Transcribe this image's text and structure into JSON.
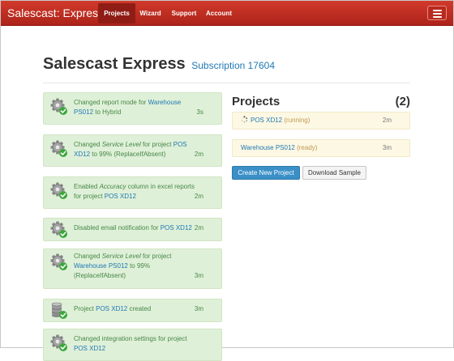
{
  "navbar": {
    "brand": "Salescast: Express",
    "items": [
      {
        "label": "Projects",
        "active": true
      },
      {
        "label": "Wizard",
        "active": false
      },
      {
        "label": "Support",
        "active": false
      },
      {
        "label": "Account",
        "active": false
      }
    ],
    "menu_icon": "hamburger-menu-icon"
  },
  "header": {
    "title": "Salescast Express",
    "subscription": "Subscription 17604"
  },
  "feed": [
    {
      "icon": "gear-check-icon",
      "time": "3s",
      "parts": [
        {
          "t": "Changed report mode for "
        },
        {
          "t": "Warehouse PS012",
          "link": true
        },
        {
          "t": " to Hybrid"
        }
      ]
    },
    {
      "icon": "gear-check-icon",
      "time": "2m",
      "parts": [
        {
          "t": "Changed "
        },
        {
          "t": "Service Level",
          "em": true
        },
        {
          "t": " for project "
        },
        {
          "t": "POS XD12",
          "link": true
        },
        {
          "t": " to 99% (ReplaceIfAbsent)"
        }
      ]
    },
    {
      "icon": "gear-check-icon",
      "time": "2m",
      "parts": [
        {
          "t": "Enabled "
        },
        {
          "t": "Accuracy",
          "em": true
        },
        {
          "t": " column in excel reports for project "
        },
        {
          "t": "POS XD12",
          "link": true
        }
      ]
    },
    {
      "icon": "gear-check-icon",
      "time": "2m",
      "parts": [
        {
          "t": "Disabled email notification for "
        },
        {
          "t": "POS XD12",
          "link": true
        }
      ]
    },
    {
      "icon": "gear-check-icon",
      "time": "3m",
      "parts": [
        {
          "t": "Changed "
        },
        {
          "t": "Service Level",
          "em": true
        },
        {
          "t": " for project "
        },
        {
          "t": "Warehouse PS012",
          "link": true
        },
        {
          "t": " to 99% (ReplaceIfAbsent)"
        }
      ]
    },
    {
      "icon": "database-check-icon",
      "time": "3m",
      "parts": [
        {
          "t": "Project "
        },
        {
          "t": "POS XD12",
          "link": true
        },
        {
          "t": " created"
        }
      ]
    },
    {
      "icon": "gear-check-icon",
      "time": "",
      "parts": [
        {
          "t": "Changed integration settings for project "
        },
        {
          "t": "POS XD12",
          "link": true
        }
      ]
    }
  ],
  "projects": {
    "heading": "Projects",
    "count": "(2)",
    "items": [
      {
        "icon": "spinner-icon",
        "name": "POS XD12",
        "status": "(running)",
        "time": "2m"
      },
      {
        "name": "Warehouse PS012",
        "status": "(ready)",
        "time": "3m"
      }
    ],
    "create_label": "Create New Project",
    "download_label": "Download Sample"
  },
  "colors": {
    "navbar": "#c0392b",
    "feed_bg": "#dff0d8",
    "feed_text": "#468847",
    "link": "#1f78b4",
    "project_bg": "#fcf8e3",
    "primary_button": "#3a8fc7"
  }
}
